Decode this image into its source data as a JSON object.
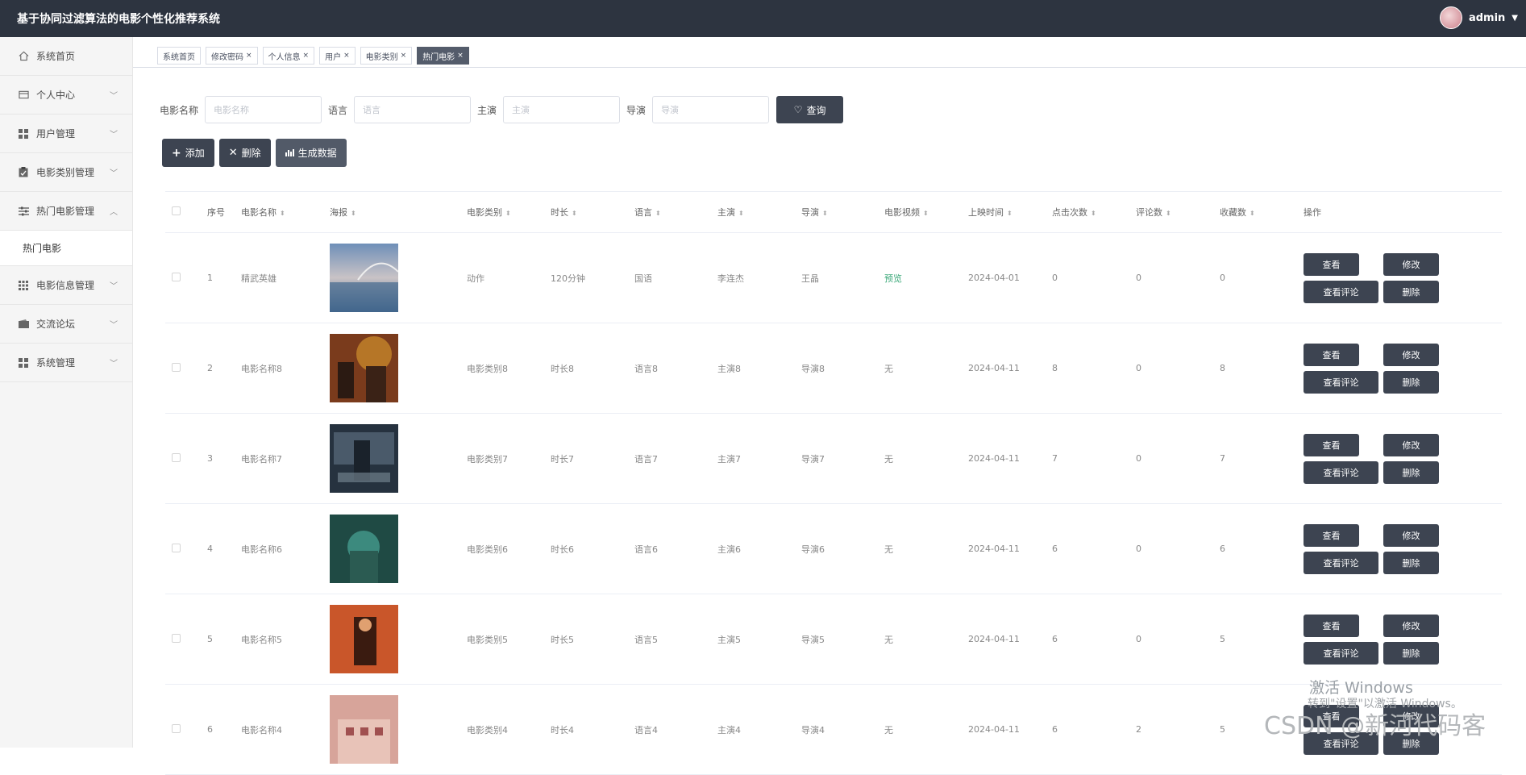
{
  "app": {
    "title": "基于协同过滤算法的电影个性化推荐系统"
  },
  "user": {
    "name": "admin"
  },
  "sidebar": {
    "items": [
      {
        "label": "系统首页"
      },
      {
        "label": "个人中心"
      },
      {
        "label": "用户管理"
      },
      {
        "label": "电影类别管理"
      },
      {
        "label": "热门电影管理"
      },
      {
        "label": "电影信息管理"
      },
      {
        "label": "交流论坛"
      },
      {
        "label": "系统管理"
      }
    ],
    "sub_item": "热门电影"
  },
  "tabs": [
    "系统首页",
    "修改密码",
    "个人信息",
    "用户",
    "电影类别",
    "热门电影"
  ],
  "search": {
    "name_label": "电影名称",
    "name_placeholder": "电影名称",
    "lang_label": "语言",
    "lang_placeholder": "语言",
    "actor_label": "主演",
    "actor_placeholder": "主演",
    "director_label": "导演",
    "director_placeholder": "导演",
    "button": "查询"
  },
  "actions": {
    "add": "添加",
    "delete": "删除",
    "generate": "生成数据"
  },
  "table": {
    "headers": [
      "序号",
      "电影名称",
      "海报",
      "电影类别",
      "时长",
      "语言",
      "主演",
      "导演",
      "电影视频",
      "上映时间",
      "点击次数",
      "评论数",
      "收藏数",
      "操作"
    ],
    "op_labels": {
      "view": "查看",
      "edit": "修改",
      "comments": "查看评论",
      "delete": "删除"
    },
    "rows": [
      {
        "no": "1",
        "name": "精武英雄",
        "category": "动作",
        "duration": "120分钟",
        "language": "国语",
        "actor": "李连杰",
        "director": "王晶",
        "video": "预览",
        "date": "2024-04-01",
        "clicks": "0",
        "comments": "0",
        "favorites": "0"
      },
      {
        "no": "2",
        "name": "电影名称8",
        "category": "电影类别8",
        "duration": "时长8",
        "language": "语言8",
        "actor": "主演8",
        "director": "导演8",
        "video": "无",
        "date": "2024-04-11",
        "clicks": "8",
        "comments": "0",
        "favorites": "8"
      },
      {
        "no": "3",
        "name": "电影名称7",
        "category": "电影类别7",
        "duration": "时长7",
        "language": "语言7",
        "actor": "主演7",
        "director": "导演7",
        "video": "无",
        "date": "2024-04-11",
        "clicks": "7",
        "comments": "0",
        "favorites": "7"
      },
      {
        "no": "4",
        "name": "电影名称6",
        "category": "电影类别6",
        "duration": "时长6",
        "language": "语言6",
        "actor": "主演6",
        "director": "导演6",
        "video": "无",
        "date": "2024-04-11",
        "clicks": "6",
        "comments": "0",
        "favorites": "6"
      },
      {
        "no": "5",
        "name": "电影名称5",
        "category": "电影类别5",
        "duration": "时长5",
        "language": "语言5",
        "actor": "主演5",
        "director": "导演5",
        "video": "无",
        "date": "2024-04-11",
        "clicks": "6",
        "comments": "0",
        "favorites": "5"
      },
      {
        "no": "6",
        "name": "电影名称4",
        "category": "电影类别4",
        "duration": "时长4",
        "language": "语言4",
        "actor": "主演4",
        "director": "导演4",
        "video": "无",
        "date": "2024-04-11",
        "clicks": "6",
        "comments": "2",
        "favorites": "5"
      }
    ]
  },
  "watermark": {
    "line1": "激活 Windows",
    "line2": "转到\"设置\"以激活 Windows。",
    "line3": "CSDN @新河代码客"
  }
}
